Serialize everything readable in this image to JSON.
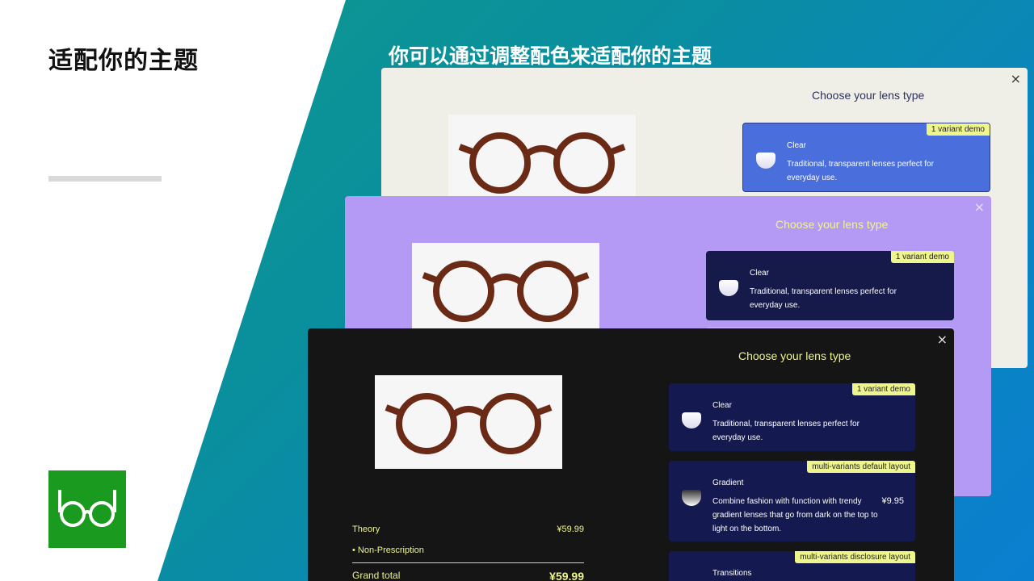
{
  "slide": {
    "title": "适配你的主题",
    "subtitle": "你可以通过调整配色来适配你的主题"
  },
  "modals": {
    "beige": {
      "title": "Choose your lens type",
      "close": "×",
      "option1": {
        "name": "Clear",
        "desc": "Traditional, transparent lenses perfect for everyday use.",
        "badge": "1 variant demo"
      }
    },
    "purple": {
      "title": "Choose your lens type",
      "close": "×",
      "option1": {
        "name": "Clear",
        "desc": "Traditional, transparent lenses perfect for everyday use.",
        "badge": "1 variant demo"
      }
    },
    "dark": {
      "title": "Choose your lens type",
      "close": "×",
      "option1": {
        "name": "Clear",
        "desc": "Traditional, transparent lenses perfect for everyday use.",
        "badge": "1 variant demo"
      },
      "option2": {
        "name": "Gradient",
        "desc": "Combine fashion with function with trendy gradient lenses that go from dark on the top to light on the bottom.",
        "price": "¥9.95",
        "badge": "multi-variants default layout"
      },
      "option3": {
        "name": "Transitions",
        "badge": "multi-variants disclosure layout"
      },
      "summary": {
        "product_name": "Theory",
        "product_price": "¥59.99",
        "prescription": "• Non-Prescription",
        "total_label": "Grand total",
        "total_price": "¥59.99"
      }
    }
  },
  "colors": {
    "beige_bg": "#efefe8",
    "purple_bg": "#b59af5",
    "dark_bg": "#151515",
    "option_navy": "#141a4f",
    "option_blue": "#4a6edb",
    "badge_yellow": "#eef58a",
    "logo_green": "#1a9a1e"
  }
}
